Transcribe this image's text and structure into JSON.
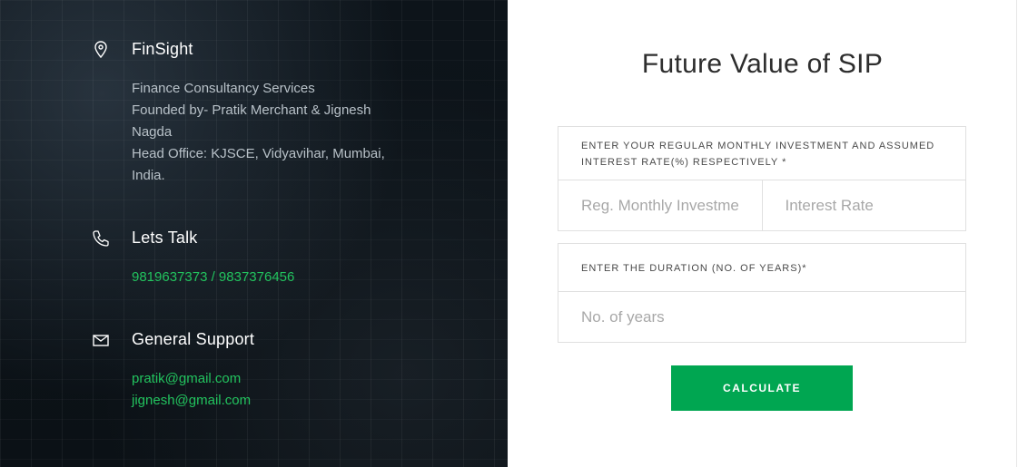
{
  "company": {
    "name": "FinSight",
    "lines": [
      "Finance Consultancy Services",
      "Founded by- Pratik Merchant & Jignesh Nagda",
      "Head Office: KJSCE, Vidyavihar, Mumbai, India."
    ],
    "icon": "location-pin-icon"
  },
  "talk": {
    "title": "Lets Talk",
    "phones": "9819637373 / 9837376456",
    "icon": "phone-icon"
  },
  "support": {
    "title": "General Support",
    "emails": [
      "pratik@gmail.com",
      "jignesh@gmail.com"
    ],
    "icon": "mail-icon"
  },
  "form": {
    "title": "Future Value of SIP",
    "investment_label": "ENTER YOUR REGULAR MONTHLY INVESTMENT AND ASSUMED INTEREST RATE(%) RESPECTIVELY *",
    "investment_placeholder": "Reg. Monthly Investment",
    "rate_placeholder": "Interest Rate",
    "duration_label": "ENTER THE DURATION (NO. OF YEARS)*",
    "duration_placeholder": "No. of years",
    "button_label": "CALCULATE"
  },
  "colors": {
    "accent": "#00a651",
    "link_green": "#22c35e"
  }
}
